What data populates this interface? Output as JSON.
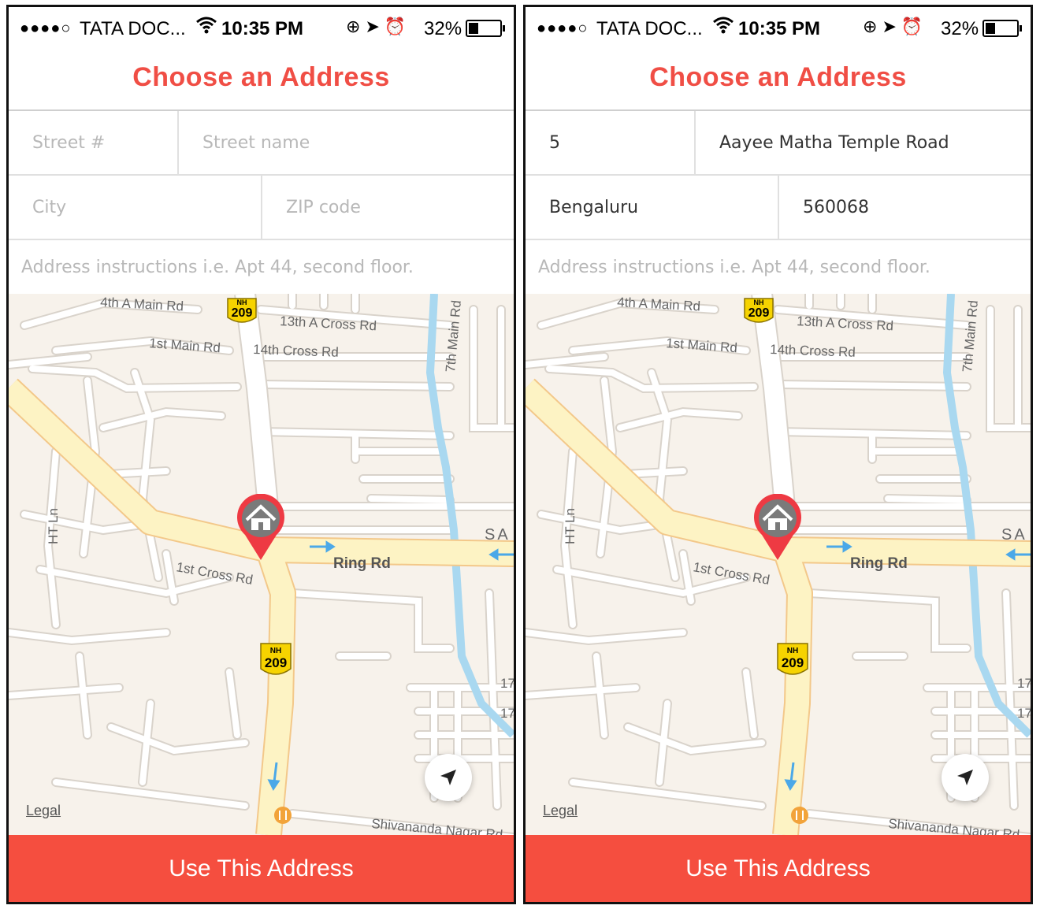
{
  "screens": [
    {
      "status": {
        "carrier": "TATA DOC...",
        "time": "10:35 PM",
        "battery": "32%",
        "battery_level": 0.32
      },
      "title": "Choose an Address",
      "fields": {
        "street_no": {
          "placeholder": "Street #",
          "value": ""
        },
        "street_name": {
          "placeholder": "Street name",
          "value": ""
        },
        "city": {
          "placeholder": "City",
          "value": ""
        },
        "zip": {
          "placeholder": "ZIP code",
          "value": ""
        },
        "instructions": {
          "placeholder": "Address instructions i.e. Apt 44, second floor.",
          "value": ""
        }
      },
      "map": {
        "labels": {
          "4th_a_main": "4th A Main Rd",
          "13th_a_cross": "13th A Cross Rd",
          "1st_main": "1st Main Rd",
          "14th_cross": "14th Cross Rd",
          "7th_main": "7th Main Rd",
          "ht_ln": "HT Ln",
          "sa": "SA",
          "ring_rd": "Ring Rd",
          "1st_cross": "1st Cross Rd",
          "shivananda": "Shivananda Nagar Rd",
          "17a": "17",
          "17b": "17"
        },
        "shields": [
          {
            "top": "NH",
            "num": "209"
          },
          {
            "top": "NH",
            "num": "209"
          }
        ],
        "legal": "Legal",
        "pin_icon": "home-icon",
        "locate_icon": "location-arrow-icon",
        "poi_icon": "fork-knife-icon"
      },
      "cta": "Use This Address"
    },
    {
      "status": {
        "carrier": "TATA DOC...",
        "time": "10:35 PM",
        "battery": "32%",
        "battery_level": 0.32
      },
      "title": "Choose an Address",
      "fields": {
        "street_no": {
          "placeholder": "Street #",
          "value": "5"
        },
        "street_name": {
          "placeholder": "Street name",
          "value": "Aayee Matha Temple Road"
        },
        "city": {
          "placeholder": "City",
          "value": "Bengaluru"
        },
        "zip": {
          "placeholder": "ZIP code",
          "value": "560068"
        },
        "instructions": {
          "placeholder": "Address instructions i.e. Apt 44, second floor.",
          "value": ""
        }
      },
      "map": {
        "labels": {
          "4th_a_main": "4th A Main Rd",
          "13th_a_cross": "13th A Cross Rd",
          "1st_main": "1st Main Rd",
          "14th_cross": "14th Cross Rd",
          "7th_main": "7th Main Rd",
          "ht_ln": "HT Ln",
          "sa": "SA",
          "ring_rd": "Ring Rd",
          "1st_cross": "1st Cross Rd",
          "shivananda": "Shivananda Nagar Rd",
          "17a": "17",
          "17b": "17"
        },
        "shields": [
          {
            "top": "NH",
            "num": "209"
          },
          {
            "top": "NH",
            "num": "209"
          }
        ],
        "legal": "Legal",
        "pin_icon": "home-icon",
        "locate_icon": "location-arrow-icon",
        "poi_icon": "fork-knife-icon"
      },
      "cta": "Use This Address"
    }
  ],
  "colors": {
    "accent": "#F04E45",
    "cta": "#F54E3F",
    "map_bg": "#F7F2EB",
    "major_road": "#FDF3C4",
    "road_edge": "#F3C88A",
    "water": "#A9D8F0"
  }
}
